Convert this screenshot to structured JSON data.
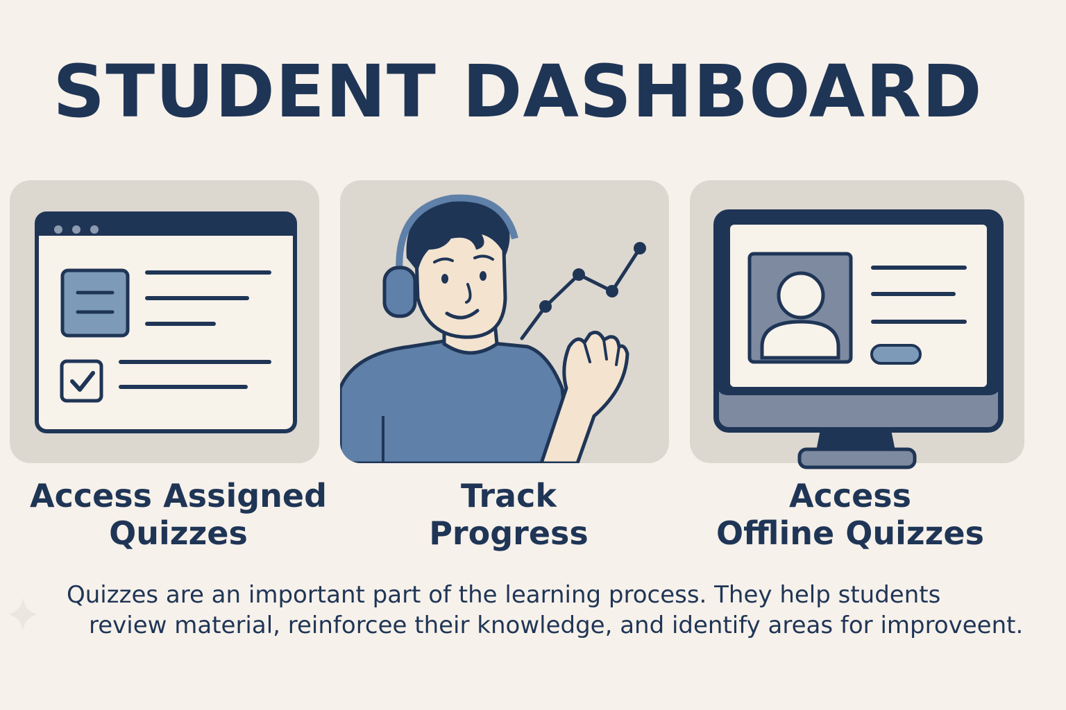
{
  "title": "STUDENT DASHBOARD",
  "cards": [
    {
      "label_line1": "Access Assigned",
      "label_line2": "Quizzes",
      "icon": "quiz-window-icon"
    },
    {
      "label_line1": "Track",
      "label_line2": "Progress",
      "icon": "student-progress-illustration"
    },
    {
      "label_line1": "Access",
      "label_line2": "Offline Quizzes",
      "icon": "desktop-profile-icon"
    }
  ],
  "description": {
    "line1": "Quizzes are an important part of the learning process. They help students",
    "line2": "review material, reinforcee their knowledge, and identify areas for improveent."
  },
  "colors": {
    "background": "#f6f1ea",
    "navy": "#1f3556",
    "card": "#dcd7cf",
    "accent_blue": "#6f8fb4",
    "skin": "#f3e3cf"
  }
}
